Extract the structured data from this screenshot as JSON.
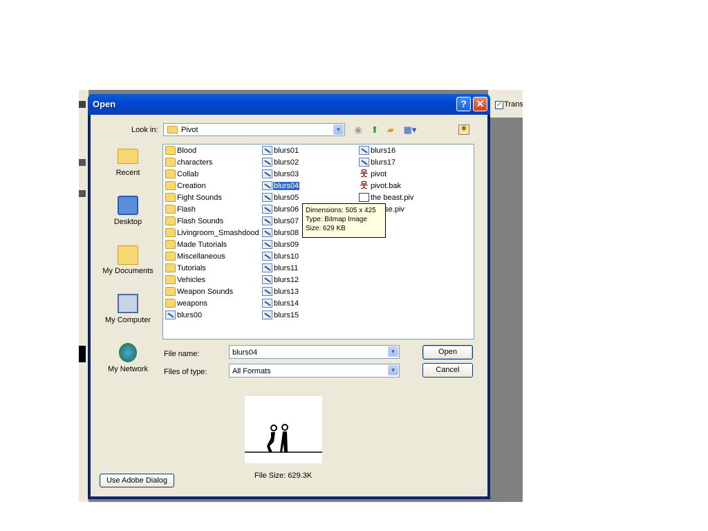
{
  "background": {
    "transparent_checkbox_label": "Transp"
  },
  "dialog": {
    "title": "Open",
    "help_label": "?",
    "close_label": "✕"
  },
  "lookin": {
    "label": "Look in:",
    "value": "Pivot"
  },
  "places": [
    {
      "label": "Recent",
      "icon": "recent-folder-icon"
    },
    {
      "label": "Desktop",
      "icon": "desktop-icon"
    },
    {
      "label": "My Documents",
      "icon": "my-documents-icon"
    },
    {
      "label": "My Computer",
      "icon": "my-computer-icon"
    },
    {
      "label": "My Network",
      "icon": "my-network-icon"
    }
  ],
  "files": {
    "col1": [
      "Blood",
      "characters",
      "Collab",
      "Creation",
      "Fight Sounds",
      "Flash",
      "Flash Sounds",
      "Livingroom_Smashdood",
      "Made Tutorials",
      "Miscellaneous",
      "Tutorials",
      "Vehicles",
      "Weapon Sounds",
      "weapons",
      "blurs00"
    ],
    "col2": [
      "blurs01",
      "blurs02",
      "blurs03",
      "blurs04",
      "blurs05",
      "blurs06",
      "blurs07",
      "blurs08",
      "blurs09",
      "blurs10",
      "blurs11",
      "blurs12",
      "blurs13",
      "blurs14",
      "blurs15"
    ],
    "col3": [
      "blurs16",
      "blurs17",
      "pivot",
      "pivot.bak",
      "the beast.piv",
      "Chase.piv"
    ],
    "selected": "blurs04"
  },
  "tooltip": {
    "line1": "Dimensions: 505 x 425",
    "line2": "Type: Bitmap Image",
    "line3": "Size: 629 KB"
  },
  "filename": {
    "label": "File name:",
    "value": "blurs04"
  },
  "filetype": {
    "label": "Files of type:",
    "value": "All Formats"
  },
  "buttons": {
    "open": "Open",
    "cancel": "Cancel",
    "adobe": "Use Adobe Dialog"
  },
  "preview": {
    "file_size": "File Size: 629.3K"
  }
}
